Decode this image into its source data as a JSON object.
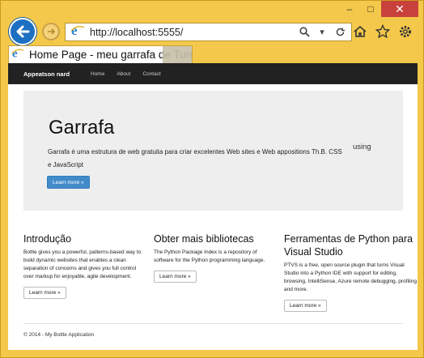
{
  "browser": {
    "url": "http://localhost:5555/",
    "tab_title": "Home Page - meu garrafa de Turma...",
    "caption": {
      "minimize": "–",
      "maximize": "□",
      "close": "✕"
    }
  },
  "nav": {
    "brand": "Appeatson nard",
    "links": [
      "Home",
      "About",
      "Contact"
    ]
  },
  "jumbotron": {
    "title": "Garrafa",
    "lead": "Garrafa é uma estrutura de web gratuita para criar excelentes Web sites e Web appositions Th.B. CSS e JavaScript",
    "using": "using",
    "button": "Learn more »"
  },
  "columns": [
    {
      "title": "Introdução",
      "text": "Bottle gives you a powerful, patterns-based way to build dynamic websites that enables a clean separation of concerns and gives you full control over markup for enjoyable, agile development.",
      "button": "Learn more »"
    },
    {
      "title": "Obter mais bibliotecas",
      "text": "The Python Package Index is a repository of software for the Python programming language.",
      "button": "Learn more »"
    },
    {
      "title": "Ferramentas de Python para Visual Studio",
      "text": "PTVS is a free, open source plugin that turns Visual Studio into a Python IDE with support for editing, browsing, IntelliSense, Azure remote debugging, profiling and more.",
      "button": "Learn more »"
    }
  ],
  "footer": "© 2014 - My Bottle Application",
  "colors": {
    "frame": "#f4c84a",
    "navbar": "#222222",
    "primary": "#428bca",
    "close": "#c9413b"
  }
}
